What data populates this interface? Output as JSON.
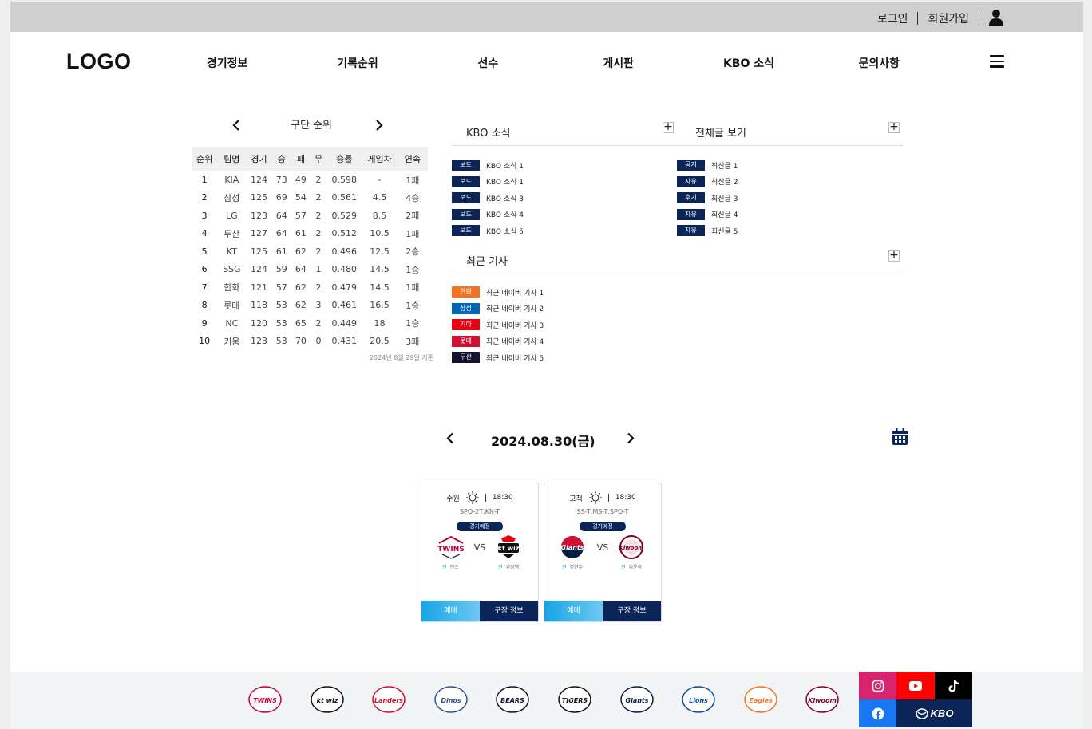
{
  "topbar": {
    "login": "로그인",
    "signup": "회원가입"
  },
  "header": {
    "logo": "LOGO",
    "nav": [
      "경기정보",
      "기록순위",
      "선수",
      "게시판",
      "KBO 소식",
      "문의사항"
    ]
  },
  "standings": {
    "title": "구단 순위",
    "columns": [
      "순위",
      "팀명",
      "경기",
      "승",
      "패",
      "무",
      "승률",
      "게임차",
      "연속"
    ],
    "rows": [
      [
        "1",
        "KIA",
        "124",
        "73",
        "49",
        "2",
        "0.598",
        "-",
        "1패"
      ],
      [
        "2",
        "삼성",
        "125",
        "69",
        "54",
        "2",
        "0.561",
        "4.5",
        "4승"
      ],
      [
        "3",
        "LG",
        "123",
        "64",
        "57",
        "2",
        "0.529",
        "8.5",
        "2패"
      ],
      [
        "4",
        "두산",
        "127",
        "64",
        "61",
        "2",
        "0.512",
        "10.5",
        "1패"
      ],
      [
        "5",
        "KT",
        "125",
        "61",
        "62",
        "2",
        "0.496",
        "12.5",
        "2승"
      ],
      [
        "6",
        "SSG",
        "124",
        "59",
        "64",
        "1",
        "0.480",
        "14.5",
        "1승"
      ],
      [
        "7",
        "한화",
        "121",
        "57",
        "62",
        "2",
        "0.479",
        "14.5",
        "1패"
      ],
      [
        "8",
        "롯데",
        "118",
        "53",
        "62",
        "3",
        "0.461",
        "16.5",
        "1승"
      ],
      [
        "9",
        "NC",
        "120",
        "53",
        "65",
        "2",
        "0.449",
        "18",
        "1승"
      ],
      [
        "10",
        "키움",
        "123",
        "53",
        "70",
        "0",
        "0.431",
        "20.5",
        "3패"
      ]
    ],
    "note": "2024년 8월 29일 기준"
  },
  "kbo_news": {
    "title": "KBO 소식",
    "items": [
      {
        "badge": "보도",
        "text": "KBO 소식 1",
        "color": "#0c2558"
      },
      {
        "badge": "보도",
        "text": "KBO 소식 1",
        "color": "#0c2558"
      },
      {
        "badge": "보도",
        "text": "KBO 소식 3",
        "color": "#0c2558"
      },
      {
        "badge": "보도",
        "text": "KBO 소식 4",
        "color": "#0c2558"
      },
      {
        "badge": "보도",
        "text": "KBO 소식 5",
        "color": "#0c2558"
      }
    ]
  },
  "all_posts": {
    "title": "전체글 보기",
    "items": [
      {
        "badge": "공지",
        "text": "최신글 1",
        "color": "#0c2558"
      },
      {
        "badge": "자유",
        "text": "최신글 2",
        "color": "#0c2558"
      },
      {
        "badge": "후기",
        "text": "최신글 3",
        "color": "#0c2558"
      },
      {
        "badge": "자유",
        "text": "최신글 4",
        "color": "#0c2558"
      },
      {
        "badge": "자유",
        "text": "최신글 5",
        "color": "#0c2558"
      }
    ]
  },
  "recent_articles": {
    "title": "최근 기사",
    "items": [
      {
        "badge": "한화",
        "text": "최근 네이버 기사 1",
        "color": "#f37321"
      },
      {
        "badge": "삼성",
        "text": "최근 네이버 기사 2",
        "color": "#0066b3"
      },
      {
        "badge": "기아",
        "text": "최근 네이버 기사 3",
        "color": "#e60012"
      },
      {
        "badge": "롯데",
        "text": "최근 네이버 기사 4",
        "color": "#d00f31"
      },
      {
        "badge": "두산",
        "text": "최근 네이버 기사 5",
        "color": "#131230"
      }
    ]
  },
  "schedule": {
    "date": "2024.08.30(금)",
    "games": [
      {
        "stadium": "수원",
        "weather_icon": "sun-icon",
        "time": "18:30",
        "tv": "SPO-2T,KN-T",
        "status": "경기예정",
        "vs": "VS",
        "home_team": "TWINS",
        "away_team": "kt wiz",
        "home_pitcher_tag": "선",
        "home_pitcher": "엔스",
        "away_pitcher_tag": "선",
        "away_pitcher": "엄상백",
        "ticket": "예매",
        "stadium_info": "구장 정보"
      },
      {
        "stadium": "고척",
        "weather_icon": "sun-icon",
        "time": "18:30",
        "tv": "SS-T,MS-T,SPO-T",
        "status": "경기예정",
        "vs": "VS",
        "home_team": "Giants",
        "away_team": "Kiwoom",
        "home_pitcher_tag": "선",
        "home_pitcher": "정현수",
        "away_pitcher_tag": "선",
        "away_pitcher": "김윤하",
        "ticket": "예매",
        "stadium_info": "구장 정보"
      }
    ]
  },
  "footer": {
    "teams": [
      {
        "name": "TWINS",
        "color": "#c30037"
      },
      {
        "name": "kt wiz",
        "color": "#111111"
      },
      {
        "name": "Landers",
        "color": "#ce0e2d"
      },
      {
        "name": "Dinos",
        "color": "#315288"
      },
      {
        "name": "BEARS",
        "color": "#131230"
      },
      {
        "name": "TIGERS",
        "color": "#111111"
      },
      {
        "name": "Giants",
        "color": "#041e42"
      },
      {
        "name": "Lions",
        "color": "#074ca1"
      },
      {
        "name": "Eagles",
        "color": "#f37321"
      },
      {
        "name": "Kiwoom",
        "color": "#820024"
      }
    ],
    "social": {
      "instagram_color": "#d6246e",
      "youtube_color": "#ff0000",
      "tiktok_color": "#000000",
      "facebook_color": "#1877f2",
      "kbo_color": "#0c2558",
      "kbo_label": "KBO"
    }
  }
}
